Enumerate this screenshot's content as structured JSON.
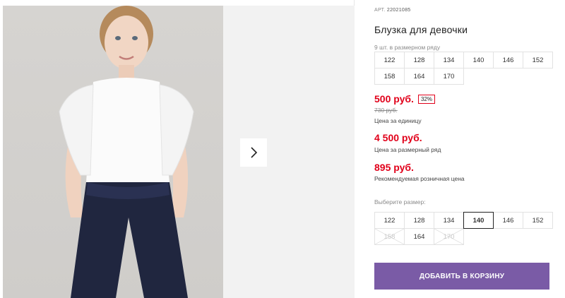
{
  "product": {
    "sku_label": "АРТ.",
    "sku": "22021085",
    "title": "Блузка для девочки",
    "row_count": "9 шт. в размерном ряду"
  },
  "size_row": [
    "122",
    "128",
    "134",
    "140",
    "146",
    "152",
    "158",
    "164",
    "170"
  ],
  "prices": {
    "unit_price": "500 руб.",
    "discount": "32%",
    "old_price": "730 руб.",
    "unit_caption": "Цена за единицу",
    "row_price": "4 500 руб.",
    "row_caption": "Цена за размерный ряд",
    "retail_price": "895 руб.",
    "retail_caption": "Рекомендуемая розничная цена"
  },
  "size_picker": {
    "label": "Выберите размер:",
    "selected": "140",
    "options": [
      {
        "label": "122",
        "available": true
      },
      {
        "label": "128",
        "available": true
      },
      {
        "label": "134",
        "available": true
      },
      {
        "label": "140",
        "available": true
      },
      {
        "label": "146",
        "available": true
      },
      {
        "label": "152",
        "available": true
      },
      {
        "label": "158",
        "available": false
      },
      {
        "label": "164",
        "available": true
      },
      {
        "label": "170",
        "available": false
      }
    ]
  },
  "cart_button": "ДОБАВИТЬ В КОРЗИНУ",
  "icons": {
    "next": "chevron-right-icon"
  },
  "colors": {
    "accent": "#7a5ba6",
    "price": "#e1001a"
  }
}
